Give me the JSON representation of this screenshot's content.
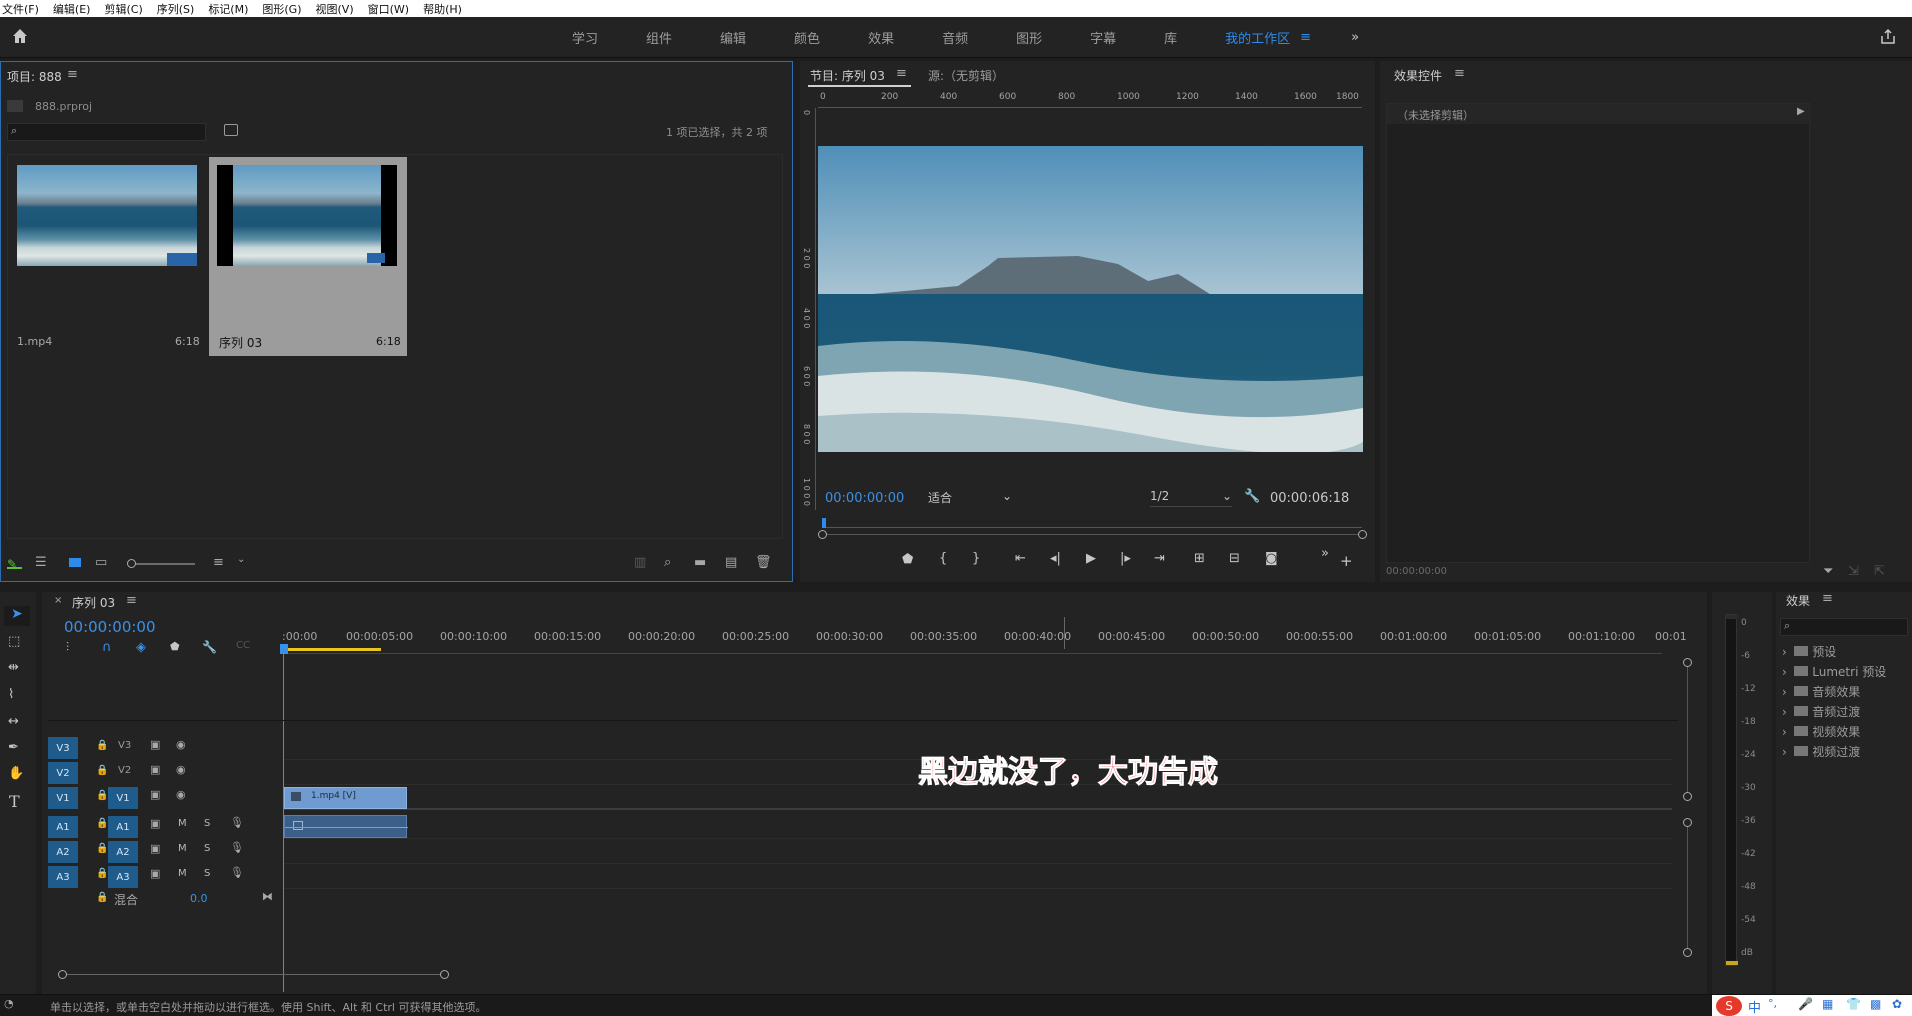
{
  "menu": [
    "文件(F)",
    "编辑(E)",
    "剪辑(C)",
    "序列(S)",
    "标记(M)",
    "图形(G)",
    "视图(V)",
    "窗口(W)",
    "帮助(H)"
  ],
  "workspaces": [
    "学习",
    "组件",
    "编辑",
    "颜色",
    "效果",
    "音频",
    "图形",
    "字幕",
    "库"
  ],
  "active_workspace": "我的工作区",
  "project": {
    "title": "项目: 888",
    "file": "888.prproj",
    "selection": "1 项已选择，共 2 项",
    "items": [
      {
        "name": "1.mp4",
        "duration": "6:18"
      },
      {
        "name": "序列 03",
        "duration": "6:18"
      }
    ]
  },
  "program": {
    "tab_program": "节目: 序列 03",
    "tab_source": "源:（无剪辑）",
    "timecode": "00:00:00:00",
    "fit": "适合",
    "resolution": "1/2",
    "duration": "00:00:06:18",
    "ruler": [
      "0",
      "200",
      "400",
      "600",
      "800",
      "1000",
      "1200",
      "1400",
      "1600",
      "1800"
    ],
    "vruler": [
      "0",
      "2 0 0",
      "4 0 0",
      "6 0 0",
      "8 0 0",
      "1 0 0 0"
    ]
  },
  "effect_controls": {
    "title": "效果控件",
    "empty": "（未选择剪辑）",
    "timecode": "00:00:00:00"
  },
  "timeline": {
    "title": "序列 03",
    "timecode": "00:00:00:00",
    "ruler": [
      ":00:00",
      "00:00:05:00",
      "00:00:10:00",
      "00:00:15:00",
      "00:00:20:00",
      "00:00:25:00",
      "00:00:30:00",
      "00:00:35:00",
      "00:00:40:00",
      "00:00:45:00",
      "00:00:50:00",
      "00:00:55:00",
      "00:01:00:00",
      "00:01:05:00",
      "00:01:10:00",
      "00:01"
    ],
    "video_tracks": [
      "V3",
      "V2",
      "V1"
    ],
    "audio_tracks": [
      "A1",
      "A2",
      "A3"
    ],
    "mix_label": "混合",
    "mix_value": "0.0",
    "clip": "1.mp4 [V]",
    "m": "M",
    "s": "S"
  },
  "overlay_caption": "黑边就没了，大功告成",
  "effects": {
    "title": "效果",
    "items": [
      "预设",
      "Lumetri 预设",
      "音频效果",
      "音频过渡",
      "视频效果",
      "视频过渡"
    ]
  },
  "meter": [
    "0",
    "-6",
    "-12",
    "-18",
    "-24",
    "-30",
    "-36",
    "-42",
    "-48",
    "-54",
    "dB"
  ],
  "status_bar": "单击以选择，或单击空白处并拖动以进行框选。使用 Shift、Alt 和 Ctrl 可获得其他选项。",
  "ime": [
    "中",
    "°,"
  ]
}
